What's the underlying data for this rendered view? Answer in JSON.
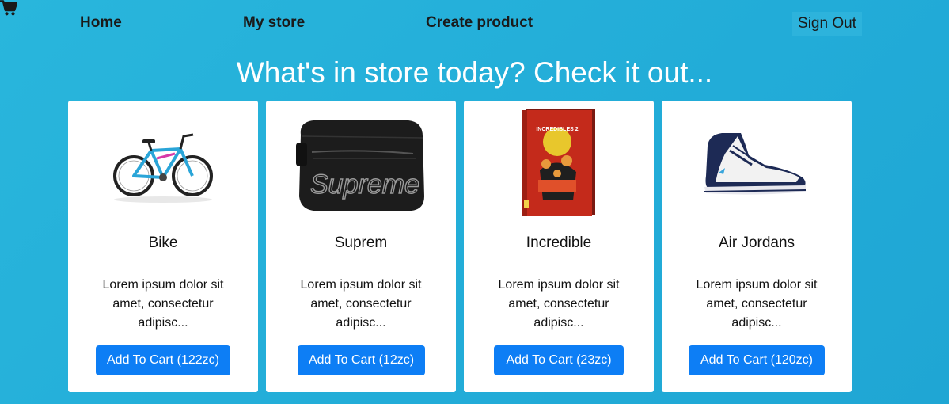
{
  "nav": {
    "home": "Home",
    "my_store": "My store",
    "create_product": "Create product",
    "cart_icon": "shopping-cart-icon",
    "sign_out": "Sign Out"
  },
  "headline": "What's in store today? Check it out...",
  "products": [
    {
      "name": "Bike",
      "description": "Lorem ipsum dolor sit amet, consectetur adipisc...",
      "button": "Add To Cart (122zc)",
      "image_icon": "bicycle-image"
    },
    {
      "name": "Suprem",
      "description": "Lorem ipsum dolor sit amet, consectetur adipisc...",
      "button": "Add To Cart (12zc)",
      "image_icon": "bag-image",
      "image_text": "Supreme"
    },
    {
      "name": "Incredible",
      "description": "Lorem ipsum dolor sit amet, consectetur adipisc...",
      "button": "Add To Cart (23zc)",
      "image_icon": "book-image",
      "image_text": "INCREDIBLES 2"
    },
    {
      "name": "Air Jordans",
      "description": "Lorem ipsum dolor sit amet, consectetur adipisc...",
      "button": "Add To Cart (120zc)",
      "image_icon": "sneaker-image"
    }
  ],
  "colors": {
    "background": "#22acd8",
    "button": "#0d7ef5",
    "card": "#ffffff"
  }
}
